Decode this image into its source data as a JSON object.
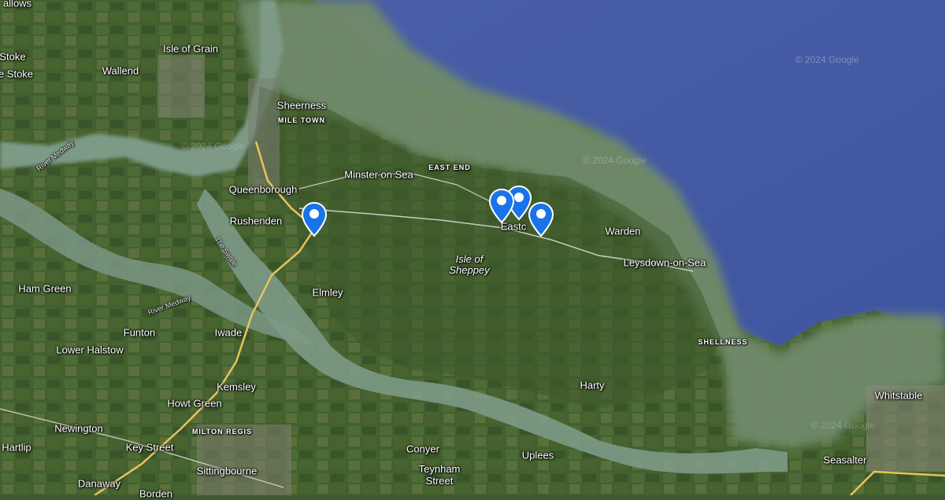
{
  "map": {
    "watermark": "© 2024 Google",
    "labels": {
      "hallows": "allows",
      "stoke": "Stoke",
      "estoke": "e Stoke",
      "isle_of_grain": "Isle of Grain",
      "wallend": "Wallend",
      "sheerness": "Sheerness",
      "mile_town": "MILE TOWN",
      "river_medway_1": "River Medway",
      "east_end": "EAST END",
      "minster": "Minster on Sea",
      "queenborough": "Queenborough",
      "rushenden": "Rushenden",
      "eastchurch": "Eastc",
      "warden": "Warden",
      "isle_of_sheppey_1": "Isle of",
      "isle_of_sheppey_2": "Sheppey",
      "leysdown": "Leysdown-on-Sea",
      "the_swale": "The Swale",
      "ham_green": "Ham Green",
      "elmley": "Elmley",
      "river_medway_2": "River Medway",
      "funton": "Funton",
      "iwade": "Iwade",
      "lower_halstow": "Lower Halstow",
      "shellness": "SHELLNESS",
      "kemsley": "Kemsley",
      "howt_green": "Howt Green",
      "harty": "Harty",
      "whitstable": "Whitstable",
      "newington": "Newington",
      "milton_regis": "MILTON REGIS",
      "hartlip": "Hartlip",
      "key_street": "Key Street",
      "conyer": "Conyer",
      "uplees": "Uplees",
      "seasalter": "Seasalter",
      "teynham_1": "Teynham",
      "teynham_2": "Street",
      "sittingbourne": "Sittingbourne",
      "danaway": "Danaway",
      "borden": "Borden"
    },
    "markers": [
      {
        "name": "marker-queenborough",
        "color": "#1a73e8"
      },
      {
        "name": "marker-eastchurch-1",
        "color": "#1a73e8"
      },
      {
        "name": "marker-eastchurch-2",
        "color": "#1a73e8"
      },
      {
        "name": "marker-eastchurch-3",
        "color": "#1a73e8"
      }
    ],
    "colors": {
      "sea_deep": "#4a62a8",
      "estuary": "#6e8a68",
      "land": "#3f5a2f",
      "marker": "#1a73e8"
    }
  }
}
